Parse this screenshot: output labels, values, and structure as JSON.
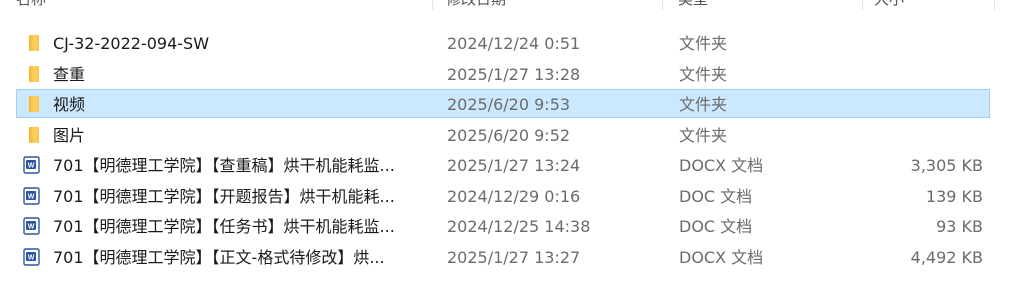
{
  "columns": {
    "name": "名称",
    "modified": "修改日期",
    "type": "类型",
    "size": "大小"
  },
  "rows": [
    {
      "name": "CJ-32-2022-094-SW",
      "modified": "2024/12/24 0:51",
      "type": "文件夹",
      "size": "",
      "icon": "folder-icon",
      "selected": false
    },
    {
      "name": "查重",
      "modified": "2025/1/27 13:28",
      "type": "文件夹",
      "size": "",
      "icon": "folder-icon",
      "selected": false
    },
    {
      "name": "视频",
      "modified": "2025/6/20 9:53",
      "type": "文件夹",
      "size": "",
      "icon": "folder-icon",
      "selected": true
    },
    {
      "name": "图片",
      "modified": "2025/6/20 9:52",
      "type": "文件夹",
      "size": "",
      "icon": "folder-icon",
      "selected": false
    },
    {
      "name": "701【明德理工学院】【查重稿】烘干机能耗监...",
      "modified": "2025/1/27 13:24",
      "type": "DOCX 文档",
      "size": "3,305 KB",
      "icon": "word-docx-icon",
      "selected": false
    },
    {
      "name": "701【明德理工学院】【开题报告】烘干机能耗...",
      "modified": "2024/12/29 0:16",
      "type": "DOC 文档",
      "size": "139 KB",
      "icon": "word-doc-icon",
      "selected": false
    },
    {
      "name": "701【明德理工学院】【任务书】烘干机能耗监...",
      "modified": "2024/12/25 14:38",
      "type": "DOC 文档",
      "size": "93 KB",
      "icon": "word-doc-icon",
      "selected": false
    },
    {
      "name": "701【明德理工学院】【正文-格式待修改】烘...",
      "modified": "2025/1/27 13:27",
      "type": "DOCX 文档",
      "size": "4,492 KB",
      "icon": "word-docx-icon",
      "selected": false
    }
  ],
  "colors": {
    "selection_bg": "#cce8ff",
    "selection_border": "#99d1ff",
    "folder": "#f7c34a",
    "word_blue": "#2b579a"
  }
}
